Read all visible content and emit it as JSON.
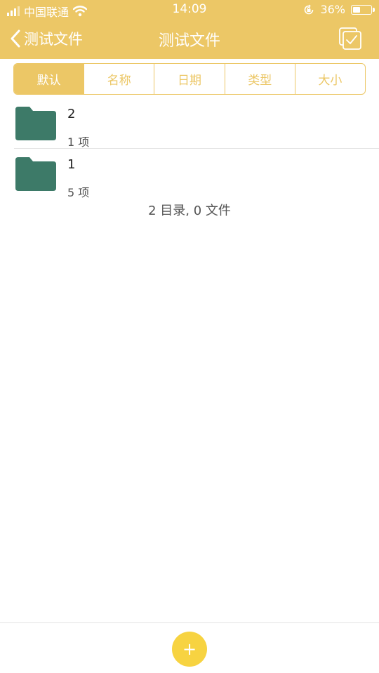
{
  "status_bar": {
    "carrier": "中国联通",
    "time": "14:09",
    "battery_percent": "36%",
    "battery_level": 0.36,
    "icons": [
      "signal-icon",
      "wifi-icon",
      "rotation-lock-icon",
      "battery-icon"
    ]
  },
  "nav": {
    "back_label": "测试文件",
    "title": "测试文件",
    "select_icon": "multi-select-checkbox-icon"
  },
  "sort_tabs": [
    {
      "label": "默认",
      "active": true
    },
    {
      "label": "名称",
      "active": false
    },
    {
      "label": "日期",
      "active": false
    },
    {
      "label": "类型",
      "active": false
    },
    {
      "label": "大小",
      "active": false
    }
  ],
  "folders": [
    {
      "name": "2",
      "count": "1 项"
    },
    {
      "name": "1",
      "count": "5 项"
    }
  ],
  "summary": "2 目录, 0 文件",
  "fab": {
    "label": "+"
  },
  "colors": {
    "accent": "#ecc766",
    "folder": "#3d7a68",
    "fab": "#f7d341"
  }
}
